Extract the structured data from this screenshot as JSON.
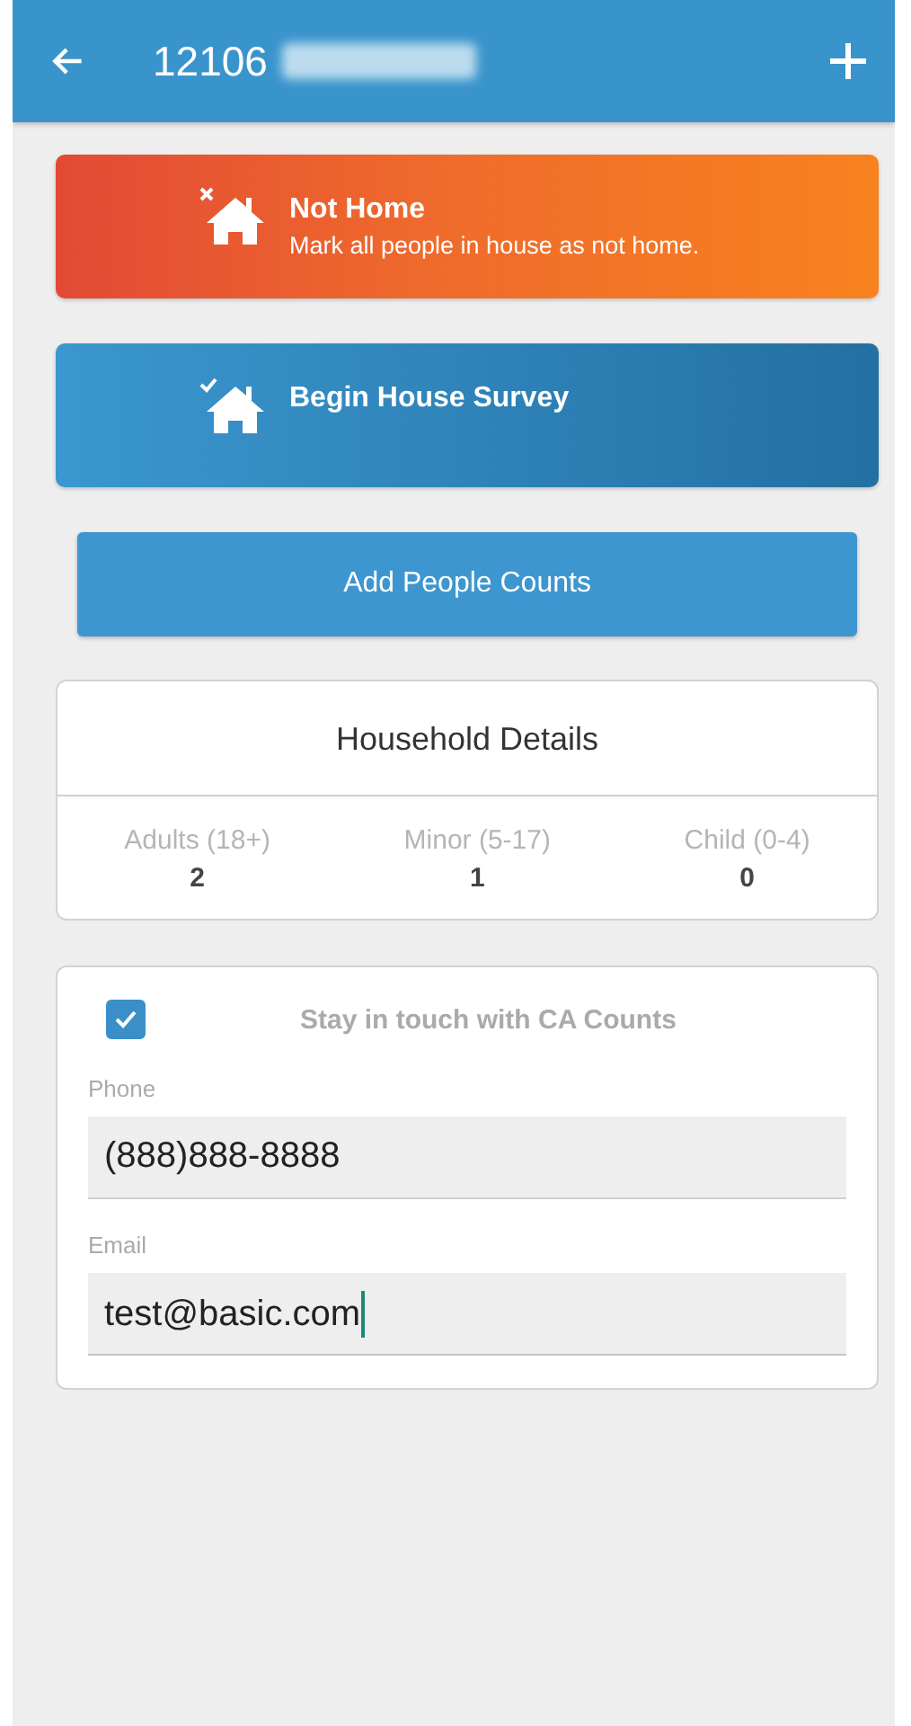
{
  "header": {
    "title": "12106",
    "redacted": true
  },
  "actions": [
    {
      "kind": "not-home",
      "title": "Not Home",
      "subtitle": "Mark all people in house as not home."
    },
    {
      "kind": "survey",
      "title": "Begin House Survey"
    }
  ],
  "add_button": "Add People Counts",
  "household": {
    "title": "Household Details",
    "counts": [
      {
        "label": "Adults (18+)",
        "value": "2"
      },
      {
        "label": "Minor (5-17)",
        "value": "1"
      },
      {
        "label": "Child (0-4)",
        "value": "0"
      }
    ]
  },
  "contact": {
    "checkbox": {
      "label": "Stay in touch with CA Counts",
      "checked": true
    },
    "fields": [
      {
        "label": "Phone",
        "value": "(888)888-8888",
        "focused": false
      },
      {
        "label": "Email",
        "value": "test@basic.com",
        "focused": true
      }
    ]
  }
}
